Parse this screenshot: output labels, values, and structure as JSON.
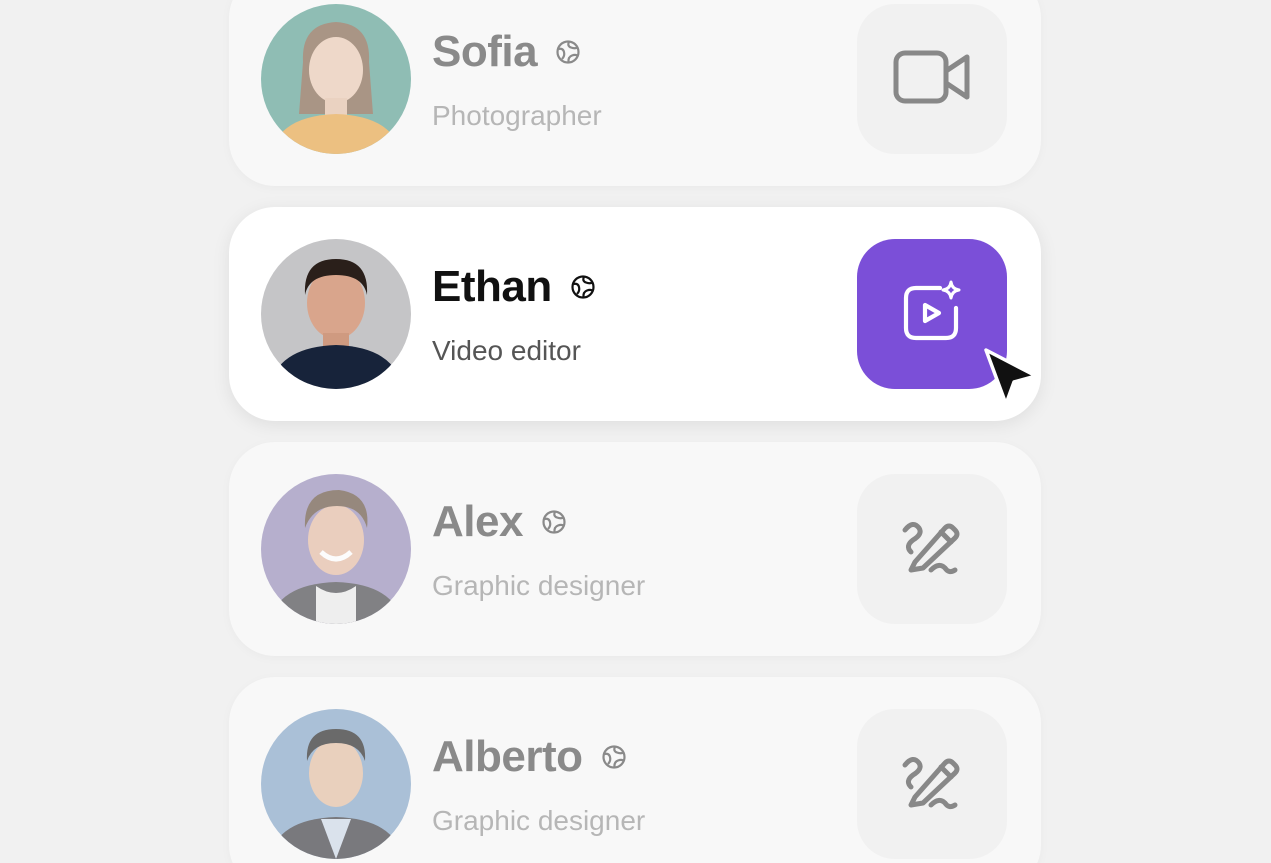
{
  "people": [
    {
      "name": "Sofia",
      "role": "Photographer",
      "action_icon": "video-camera-icon",
      "state": "dim",
      "avatar_bg": "#82b6ad"
    },
    {
      "name": "Ethan",
      "role": "Video editor",
      "action_icon": "magic-video-icon",
      "state": "active",
      "avatar_bg": "#c5c5c7"
    },
    {
      "name": "Alex",
      "role": "Graphic designer",
      "action_icon": "pen-icon",
      "state": "dim",
      "avatar_bg": "#b3aacb"
    },
    {
      "name": "Alberto",
      "role": "Graphic designer",
      "action_icon": "pen-icon",
      "state": "dim",
      "avatar_bg": "#aec4dc"
    }
  ],
  "colors": {
    "accent": "#7b4fd8",
    "background": "#f1f1f1",
    "card_active": "#ffffff",
    "card_dim": "#f8f8f8"
  }
}
